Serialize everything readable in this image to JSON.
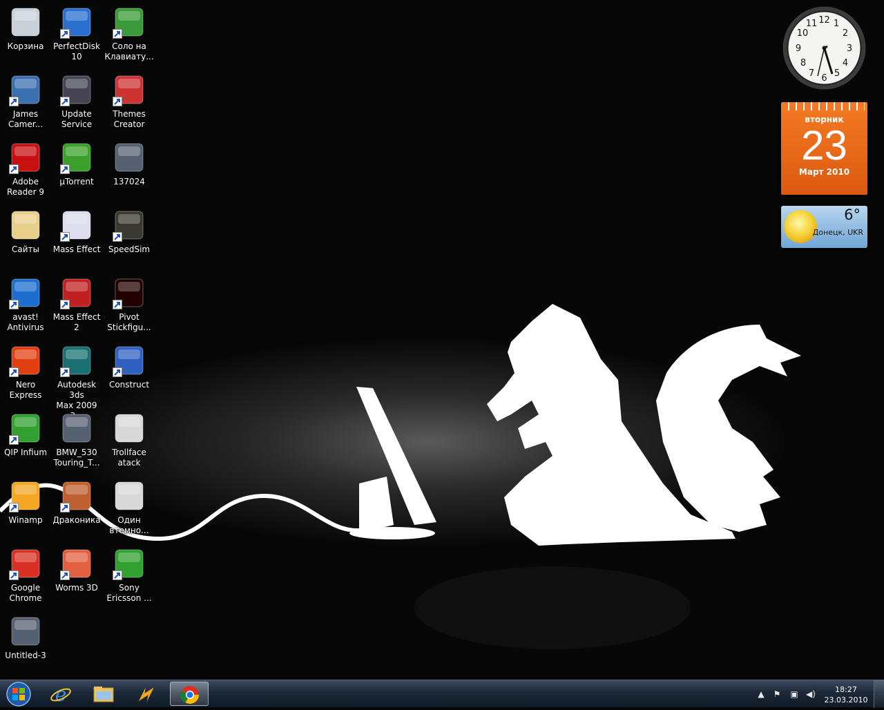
{
  "desktop": {
    "icons": [
      {
        "label": "Корзина",
        "icon": "recycle-bin-icon",
        "shortcut": false
      },
      {
        "label": "PerfectDisk\n10",
        "icon": "perfectdisk-icon",
        "shortcut": true
      },
      {
        "label": "Соло на\nКлавиату...",
        "icon": "solo-keyboard-icon",
        "shortcut": true
      },
      {
        "label": "James\nCamer...",
        "icon": "avatar-game-icon",
        "shortcut": true
      },
      {
        "label": "Update\nService",
        "icon": "update-service-icon",
        "shortcut": true
      },
      {
        "label": "Themes\nCreator",
        "icon": "themes-creator-icon",
        "shortcut": true
      },
      {
        "label": "Adobe\nReader 9",
        "icon": "adobe-reader-icon",
        "shortcut": true
      },
      {
        "label": "µTorrent",
        "icon": "utorrent-icon",
        "shortcut": true
      },
      {
        "label": "137024",
        "icon": "image-file-icon",
        "shortcut": false
      },
      {
        "label": "Сайты",
        "icon": "folder-icon",
        "shortcut": false
      },
      {
        "label": "Mass Effect",
        "icon": "mass-effect-icon",
        "shortcut": true
      },
      {
        "label": "SpeedSim",
        "icon": "speedsim-icon",
        "shortcut": true
      },
      {
        "label": "avast!\nAntivirus",
        "icon": "avast-icon",
        "shortcut": true
      },
      {
        "label": "Mass Effect 2",
        "icon": "mass-effect-2-icon",
        "shortcut": true
      },
      {
        "label": "Pivot\nStickfigu...",
        "icon": "pivot-icon",
        "shortcut": true
      },
      {
        "label": "Nero Express",
        "icon": "nero-icon",
        "shortcut": true
      },
      {
        "label": "Autodesk 3ds\nMax 2009 3...",
        "icon": "3dsmax-icon",
        "shortcut": true
      },
      {
        "label": "Construct",
        "icon": "construct-icon",
        "shortcut": true
      },
      {
        "label": "QIP Infium",
        "icon": "qip-icon",
        "shortcut": true
      },
      {
        "label": "BMW_530\nTouring_T...",
        "icon": "image-file-icon",
        "shortcut": false
      },
      {
        "label": "Trollface\natack",
        "icon": "construct-file-icon",
        "shortcut": false
      },
      {
        "label": "Winamp",
        "icon": "winamp-icon",
        "shortcut": true
      },
      {
        "label": "Драконика",
        "icon": "drakonika-icon",
        "shortcut": true
      },
      {
        "label": "Один\nвтемно...",
        "icon": "construct-file-icon",
        "shortcut": false
      },
      {
        "label": "Google\nChrome",
        "icon": "chrome-icon",
        "shortcut": true
      },
      {
        "label": "Worms 3D",
        "icon": "worms-icon",
        "shortcut": true
      },
      {
        "label": "Sony\nEricsson ...",
        "icon": "sony-ericsson-icon",
        "shortcut": true
      },
      {
        "label": "Untitled-3",
        "icon": "image-file-icon",
        "shortcut": false
      }
    ]
  },
  "gadgets": {
    "clock": {
      "time": "18:27"
    },
    "calendar": {
      "weekday": "вторник",
      "day": "23",
      "month_year": "Март 2010"
    },
    "weather": {
      "temperature": "6°",
      "city": "Донецк, UKR"
    }
  },
  "taskbar": {
    "start": "start-orb-icon",
    "pinned": [
      "internet-explorer-icon",
      "explorer-folder-icon",
      "winamp-icon",
      "chrome-icon"
    ],
    "active": "chrome-icon",
    "tray": {
      "icons": [
        "show-hidden-icons-icon",
        "action-center-flag-icon",
        "network-icon",
        "volume-icon"
      ],
      "time": "18:27",
      "date": "23.03.2010"
    }
  },
  "colors": {
    "taskbar": "#1c2838",
    "calendar": "#f47a24",
    "accent": "#ffffff"
  }
}
